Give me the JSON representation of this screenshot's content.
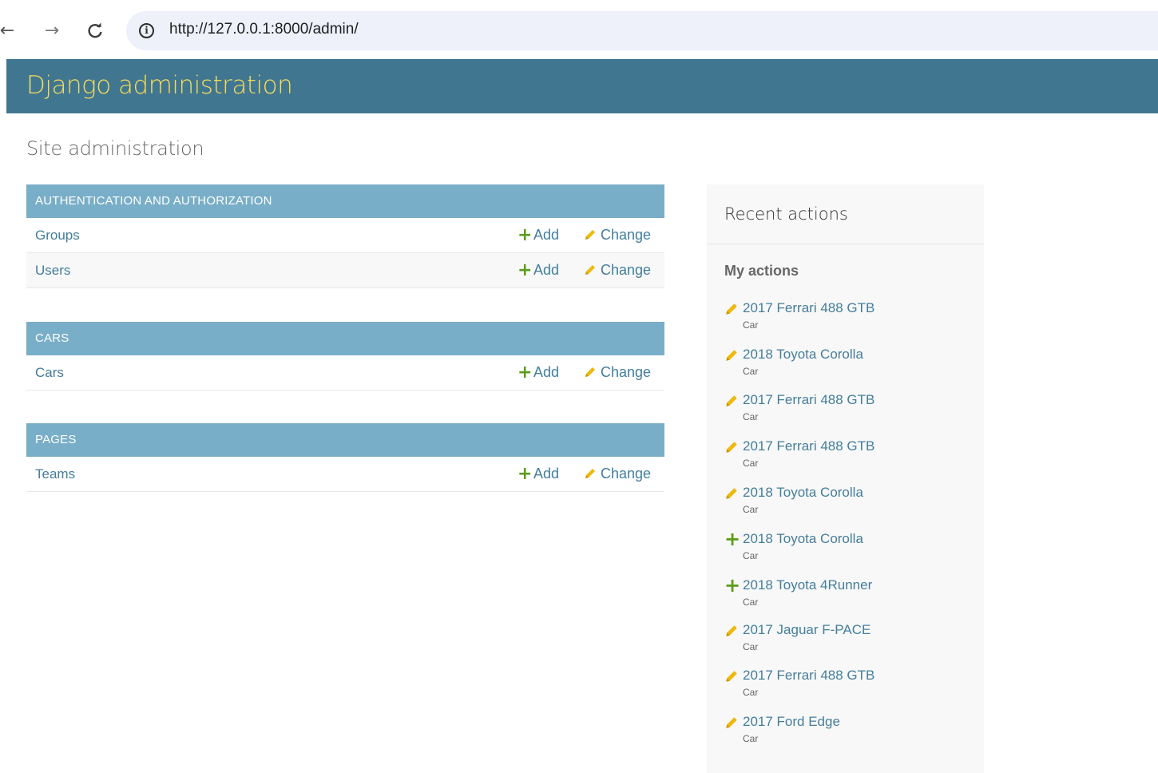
{
  "browser": {
    "url": "http://127.0.0.1:8000/admin/",
    "back_icon": "arrow-left-icon",
    "forward_icon": "arrow-right-icon",
    "reload_icon": "reload-icon",
    "info_icon": "info-icon"
  },
  "header": {
    "branding": "Django administration"
  },
  "page": {
    "title": "Site administration"
  },
  "modules": [
    {
      "caption": "AUTHENTICATION AND AUTHORIZATION",
      "rows": [
        {
          "name": "Groups",
          "add": "Add",
          "change": "Change"
        },
        {
          "name": "Users",
          "add": "Add",
          "change": "Change"
        }
      ]
    },
    {
      "caption": "CARS",
      "rows": [
        {
          "name": "Cars",
          "add": "Add",
          "change": "Change"
        }
      ]
    },
    {
      "caption": "PAGES",
      "rows": [
        {
          "name": "Teams",
          "add": "Add",
          "change": "Change"
        }
      ]
    }
  ],
  "recent": {
    "title": "Recent actions",
    "my_actions": "My actions",
    "items": [
      {
        "label": "2017 Ferrari 488 GTB",
        "type": "Car",
        "action": "change"
      },
      {
        "label": "2018 Toyota Corolla",
        "type": "Car",
        "action": "change"
      },
      {
        "label": "2017 Ferrari 488 GTB",
        "type": "Car",
        "action": "change"
      },
      {
        "label": "2017 Ferrari 488 GTB",
        "type": "Car",
        "action": "change"
      },
      {
        "label": "2018 Toyota Corolla",
        "type": "Car",
        "action": "change"
      },
      {
        "label": "2018 Toyota Corolla",
        "type": "Car",
        "action": "add"
      },
      {
        "label": "2018 Toyota 4Runner",
        "type": "Car",
        "action": "add"
      },
      {
        "label": "2017 Jaguar F-PACE",
        "type": "Car",
        "action": "change"
      },
      {
        "label": "2017 Ferrari 488 GTB",
        "type": "Car",
        "action": "change"
      },
      {
        "label": "2017 Ford Edge",
        "type": "Car",
        "action": "change"
      }
    ]
  },
  "colors": {
    "header_bg": "#417690",
    "branding": "#f5dd5d",
    "caption_bg": "#79aec8",
    "link": "#447e9b",
    "add_green": "#5c9c1c",
    "pencil_yellow": "#efb80b"
  }
}
